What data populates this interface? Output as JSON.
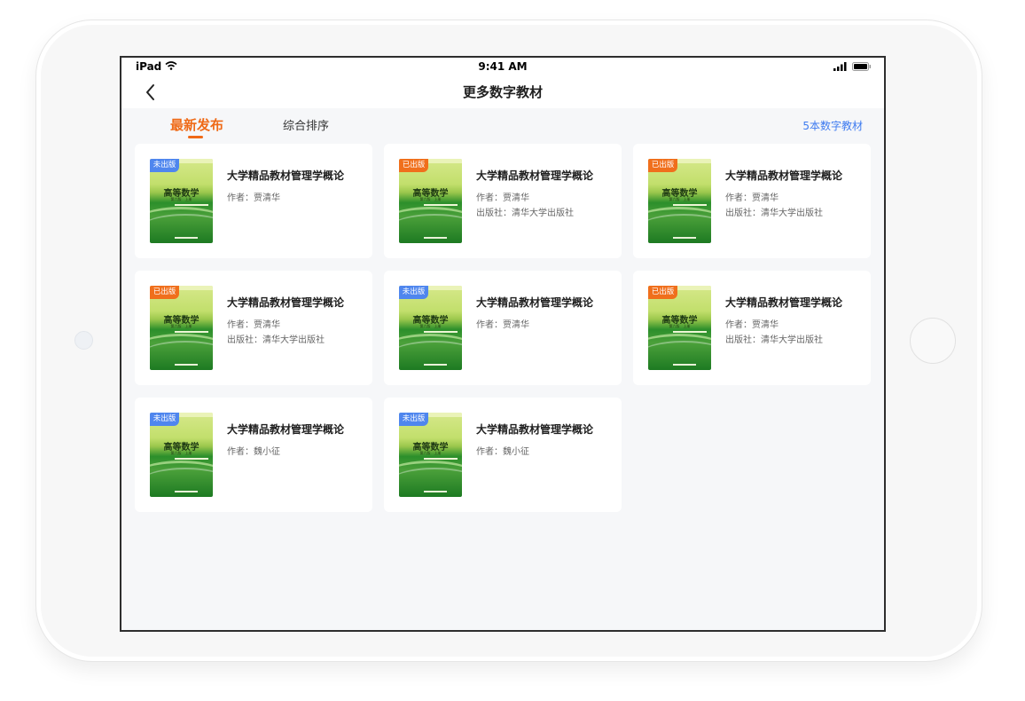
{
  "statusbar": {
    "device": "iPad",
    "time": "9:41 AM"
  },
  "navbar": {
    "title": "更多数字教材"
  },
  "tabs": [
    {
      "label": "最新发布",
      "active": true
    },
    {
      "label": "综合排序",
      "active": false
    }
  ],
  "count_label": "5本数字教材",
  "colors": {
    "accent_orange": "#ef6a17",
    "link_blue": "#3e7bf0",
    "badge_blue": "#4f86ee",
    "badge_orange": "#f06f1c"
  },
  "cover": {
    "title": "高等数学",
    "edition": "第六版　上册"
  },
  "books": [
    {
      "badge": "未出版",
      "status": "unpub",
      "title": "大学精品教材管理学概论",
      "author": "作者：贾清华",
      "publisher": ""
    },
    {
      "badge": "已出版",
      "status": "pub",
      "title": "大学精品教材管理学概论",
      "author": "作者：贾清华",
      "publisher": "出版社：清华大学出版社"
    },
    {
      "badge": "已出版",
      "status": "pub",
      "title": "大学精品教材管理学概论",
      "author": "作者：贾清华",
      "publisher": "出版社：清华大学出版社"
    },
    {
      "badge": "已出版",
      "status": "pub",
      "title": "大学精品教材管理学概论",
      "author": "作者：贾清华",
      "publisher": "出版社：清华大学出版社"
    },
    {
      "badge": "未出版",
      "status": "unpub",
      "title": "大学精品教材管理学概论",
      "author": "作者：贾清华",
      "publisher": ""
    },
    {
      "badge": "已出版",
      "status": "pub",
      "title": "大学精品教材管理学概论",
      "author": "作者：贾清华",
      "publisher": "出版社：清华大学出版社"
    },
    {
      "badge": "未出版",
      "status": "unpub",
      "title": "大学精品教材管理学概论",
      "author": "作者：魏小征",
      "publisher": ""
    },
    {
      "badge": "未出版",
      "status": "unpub",
      "title": "大学精品教材管理学概论",
      "author": "作者：魏小征",
      "publisher": ""
    }
  ]
}
